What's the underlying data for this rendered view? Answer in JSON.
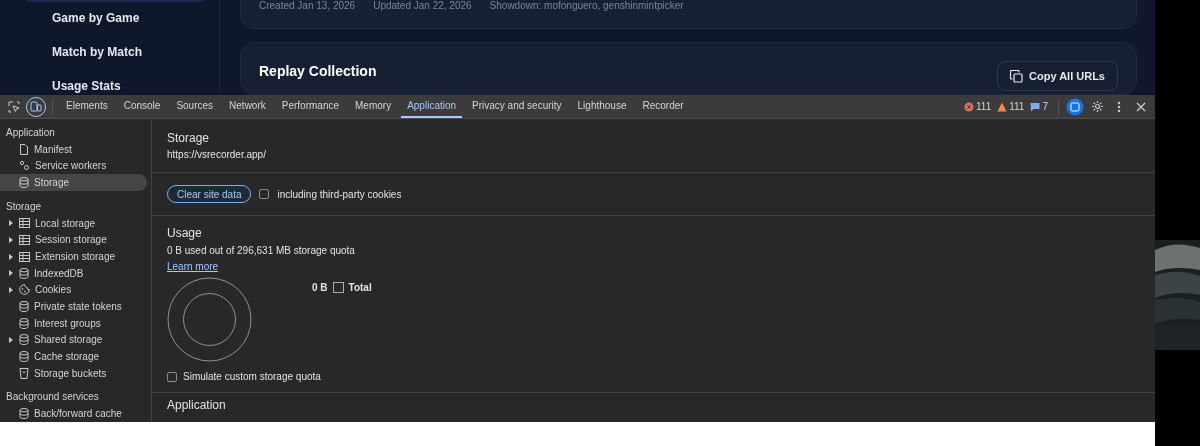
{
  "website": {
    "sidebar_items": [
      {
        "label": "Game by Game"
      },
      {
        "label": "Match by Match"
      },
      {
        "label": "Usage Stats"
      }
    ],
    "card_meta": [
      "Created Jan 13, 2026",
      "Updated Jan 22, 2026",
      "Showdown: mofonguero, genshinmintpicker"
    ],
    "replay_collection": {
      "title": "Replay Collection",
      "copy_button": "Copy All URLs"
    }
  },
  "devtools": {
    "device_mode": {
      "on": true
    },
    "tabs": [
      {
        "label": "Elements",
        "selected": false
      },
      {
        "label": "Console",
        "selected": false
      },
      {
        "label": "Sources",
        "selected": false
      },
      {
        "label": "Network",
        "selected": false
      },
      {
        "label": "Performance",
        "selected": false
      },
      {
        "label": "Memory",
        "selected": false
      },
      {
        "label": "Application",
        "selected": true
      },
      {
        "label": "Privacy and security",
        "selected": false
      },
      {
        "label": "Lighthouse",
        "selected": false
      },
      {
        "label": "Recorder",
        "selected": false
      }
    ],
    "counts": {
      "errors": "111",
      "warnings": "111",
      "messages": "7"
    },
    "sidebar": [
      {
        "title": "Application",
        "items": [
          {
            "label": "Manifest",
            "kind": "file",
            "selected": false
          },
          {
            "label": "Service workers",
            "kind": "gears",
            "selected": false
          },
          {
            "label": "Storage",
            "kind": "database",
            "selected": true
          }
        ]
      },
      {
        "title": "Storage",
        "items": [
          {
            "label": "Local storage",
            "kind": "table",
            "expanded": false,
            "selected": false
          },
          {
            "label": "Session storage",
            "kind": "table",
            "expanded": false,
            "selected": false
          },
          {
            "label": "Extension storage",
            "kind": "table",
            "expanded": false,
            "selected": false
          },
          {
            "label": "IndexedDB",
            "kind": "database",
            "expanded": false,
            "selected": false
          },
          {
            "label": "Cookies",
            "kind": "cookie",
            "expanded": false,
            "selected": false
          },
          {
            "label": "Private state tokens",
            "kind": "database",
            "selected": false
          },
          {
            "label": "Interest groups",
            "kind": "database",
            "selected": false
          },
          {
            "label": "Shared storage",
            "kind": "database",
            "expanded": false,
            "selected": false
          },
          {
            "label": "Cache storage",
            "kind": "database",
            "selected": false
          },
          {
            "label": "Storage buckets",
            "kind": "bucket",
            "selected": false
          }
        ]
      },
      {
        "title": "Background services",
        "items": [
          {
            "label": "Back/forward cache",
            "kind": "database",
            "selected": false
          }
        ]
      }
    ],
    "panel": {
      "title": "Storage",
      "origin": "https://vsrecorder.app/",
      "clear_button": "Clear site data",
      "third_party": {
        "label": "including third-party cookies",
        "checked": false
      },
      "usage_title": "Usage",
      "usage_text": "0 B used out of 296,631 MB storage quota",
      "learn_more": "Learn more",
      "legend": {
        "value": "0 B",
        "label": "Total",
        "color": "#282828"
      },
      "simulate": {
        "label": "Simulate custom storage quota",
        "checked": false
      },
      "next_section": "Application"
    }
  }
}
